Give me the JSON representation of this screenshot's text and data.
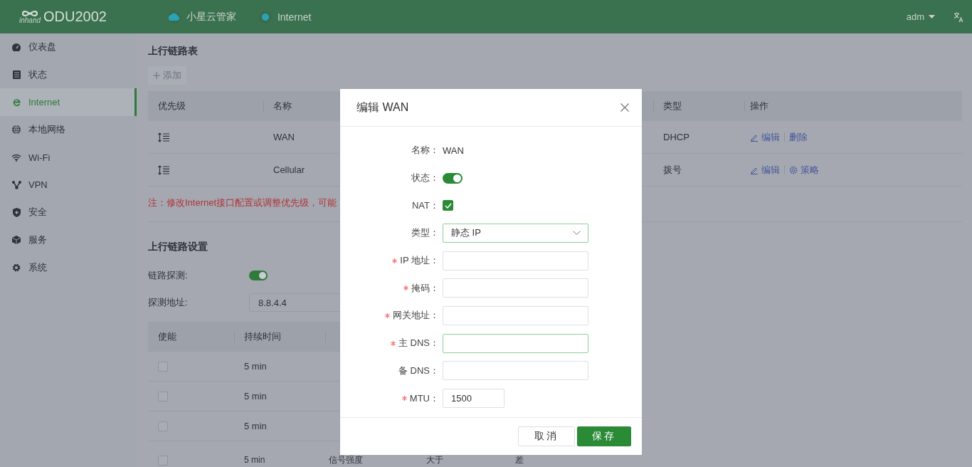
{
  "header": {
    "logo_text": "inhand",
    "product": "ODU2002",
    "nav": [
      {
        "label": "小星云管家",
        "kind": "cloud"
      },
      {
        "label": "Internet",
        "kind": "dot"
      }
    ],
    "user": "adm"
  },
  "sidebar": {
    "items": [
      {
        "label": "仪表盘",
        "selected": false
      },
      {
        "label": "状态",
        "selected": false
      },
      {
        "label": "Internet",
        "selected": true
      },
      {
        "label": "本地网络",
        "selected": false
      },
      {
        "label": "Wi-Fi",
        "selected": false
      },
      {
        "label": "VPN",
        "selected": false
      },
      {
        "label": "安全",
        "selected": false
      },
      {
        "label": "服务",
        "selected": false
      },
      {
        "label": "系统",
        "selected": false
      }
    ]
  },
  "uplink_table": {
    "title": "上行链路表",
    "add_button": "添加",
    "columns": [
      "优先级",
      "名称",
      "类型",
      "操作"
    ],
    "rows": [
      {
        "name": "WAN",
        "type": "DHCP",
        "actions": [
          {
            "label": "编辑",
            "kind": "edit"
          },
          {
            "label": "删除",
            "kind": "delete"
          }
        ]
      },
      {
        "name": "Cellular",
        "type": "拨号",
        "actions": [
          {
            "label": "编辑",
            "kind": "edit"
          },
          {
            "label": "策略",
            "kind": "policy"
          }
        ]
      }
    ]
  },
  "note": "注：修改Internet接口配置或调整优先级，可能",
  "uplink_settings": {
    "title": "上行链路设置",
    "fields": [
      {
        "label": "链路探测:",
        "kind": "switch",
        "on": true
      },
      {
        "label": "探测地址:",
        "kind": "input",
        "value": "8.8.4.4"
      }
    ]
  },
  "probe_table": {
    "columns": [
      "使能",
      "持续时间"
    ],
    "rows": [
      {
        "enabled": false,
        "duration": "5 min"
      },
      {
        "enabled": false,
        "duration": "5 min"
      },
      {
        "enabled": false,
        "duration": "5 min"
      },
      {
        "enabled": false,
        "duration": "5 min",
        "column_3": "信号强度",
        "column_4": "大于",
        "column_5": "差"
      }
    ]
  },
  "modal": {
    "title": "编辑 WAN",
    "fields": [
      {
        "label": "名称：",
        "kind": "text",
        "value": "WAN",
        "required": false
      },
      {
        "label": "状态：",
        "kind": "switch",
        "on": true,
        "required": false
      },
      {
        "label": "NAT：",
        "kind": "checkbox",
        "checked": true,
        "required": false
      },
      {
        "label": "类型：",
        "kind": "select",
        "value": "静态 IP",
        "focused": true,
        "required": false
      },
      {
        "label": "IP 地址：",
        "kind": "input",
        "required": true,
        "focused": false
      },
      {
        "label": "掩码：",
        "kind": "input",
        "required": true,
        "focused": false
      },
      {
        "label": "网关地址：",
        "kind": "input",
        "required": true,
        "focused": false
      },
      {
        "label": "主 DNS：",
        "kind": "input",
        "required": true,
        "focused": true
      },
      {
        "label": "备 DNS：",
        "kind": "input",
        "required": false,
        "focused": false
      },
      {
        "label": "MTU：",
        "kind": "short-input",
        "value": "1500",
        "required": true,
        "focused": false
      }
    ],
    "buttons": [
      {
        "label": "取消",
        "kind": "secondary"
      },
      {
        "label": "保存",
        "kind": "primary"
      }
    ]
  }
}
